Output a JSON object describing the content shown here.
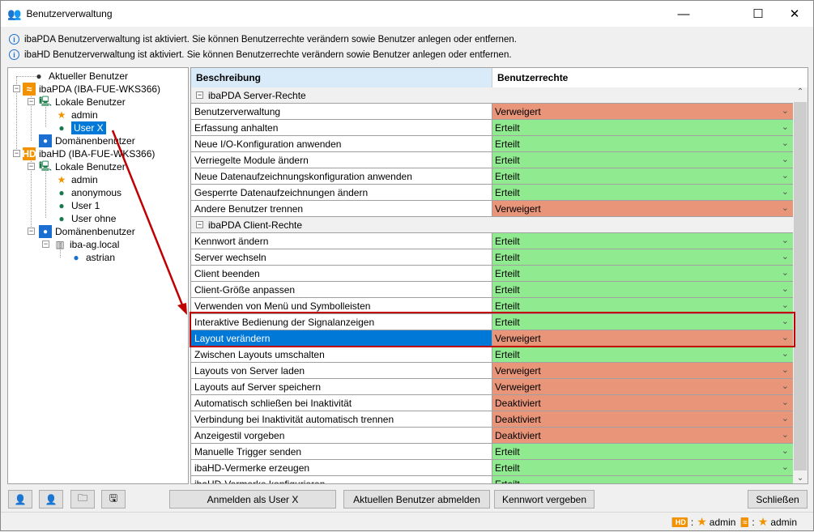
{
  "window": {
    "title": "Benutzerverwaltung",
    "minimize": "—",
    "maximize": "☐",
    "close": "✕"
  },
  "info": [
    "ibaPDA Benutzerverwaltung ist aktiviert. Sie können Benutzerrechte verändern sowie Benutzer anlegen oder entfernen.",
    "ibaHD Benutzerverwaltung ist aktiviert. Sie können Benutzerrechte verändern sowie Benutzer anlegen oder entfernen."
  ],
  "tree": {
    "current": "Aktueller Benutzer",
    "pda": "ibaPDA (IBA-FUE-WKS366)",
    "pda_local": "Lokale Benutzer",
    "pda_admin": "admin",
    "pda_userx": "User X",
    "pda_domain": "Domänenbenutzer",
    "hd": "ibaHD (IBA-FUE-WKS366)",
    "hd_local": "Lokale Benutzer",
    "hd_admin": "admin",
    "hd_anon": "anonymous",
    "hd_user1": "User 1",
    "hd_userohne": "User ohne",
    "hd_domain": "Domänenbenutzer",
    "hd_dom": "iba-ag.local",
    "hd_astrian": "astrian"
  },
  "grid": {
    "col_desc": "Beschreibung",
    "col_rights": "Benutzerrechte",
    "rows": [
      {
        "group": "ibaPDA Server-Rechte"
      },
      {
        "d": "Benutzerverwaltung",
        "v": "Verweigert"
      },
      {
        "d": "Erfassung anhalten",
        "v": "Erteilt"
      },
      {
        "d": "Neue I/O-Konfiguration anwenden",
        "v": "Erteilt"
      },
      {
        "d": "Verriegelte Module ändern",
        "v": "Erteilt"
      },
      {
        "d": "Neue Datenaufzeichnungskonfiguration anwenden",
        "v": "Erteilt"
      },
      {
        "d": "Gesperrte Datenaufzeichnungen ändern",
        "v": "Erteilt"
      },
      {
        "d": "Andere Benutzer trennen",
        "v": "Verweigert"
      },
      {
        "group": "ibaPDA Client-Rechte"
      },
      {
        "d": "Kennwort ändern",
        "v": "Erteilt"
      },
      {
        "d": "Server wechseln",
        "v": "Erteilt"
      },
      {
        "d": "Client beenden",
        "v": "Erteilt"
      },
      {
        "d": "Client-Größe anpassen",
        "v": "Erteilt"
      },
      {
        "d": "Verwenden von Menü und Symbolleisten",
        "v": "Erteilt"
      },
      {
        "d": "Interaktive Bedienung der Signalanzeigen",
        "v": "Erteilt"
      },
      {
        "d": "Layout verändern",
        "v": "Verweigert",
        "selected": true
      },
      {
        "d": "Zwischen Layouts umschalten",
        "v": "Erteilt"
      },
      {
        "d": "Layouts von Server laden",
        "v": "Verweigert"
      },
      {
        "d": "Layouts auf Server speichern",
        "v": "Verweigert"
      },
      {
        "d": "Automatisch schließen bei Inaktivität",
        "v": "Deaktiviert"
      },
      {
        "d": "Verbindung bei Inaktivität automatisch trennen",
        "v": "Deaktiviert"
      },
      {
        "d": "Anzeigestil vorgeben",
        "v": "Deaktiviert"
      },
      {
        "d": "Manuelle Trigger senden",
        "v": "Erteilt"
      },
      {
        "d": "ibaHD-Vermerke erzeugen",
        "v": "Erteilt"
      },
      {
        "d": "ibaHD-Vermerke konfigurieren",
        "v": "Erteilt"
      }
    ]
  },
  "colors": {
    "granted": "#90ea8f",
    "denied": "#e8957a",
    "selection": "#0078d7",
    "highlight": "#c00000"
  },
  "buttons": {
    "login": "Anmelden als User X",
    "logout": "Aktuellen Benutzer abmelden",
    "password": "Kennwort vergeben",
    "close": "Schließen"
  },
  "status": {
    "hd_badge": "HD",
    "hd_user": "admin",
    "pda_user": "admin",
    "sep": ":"
  }
}
